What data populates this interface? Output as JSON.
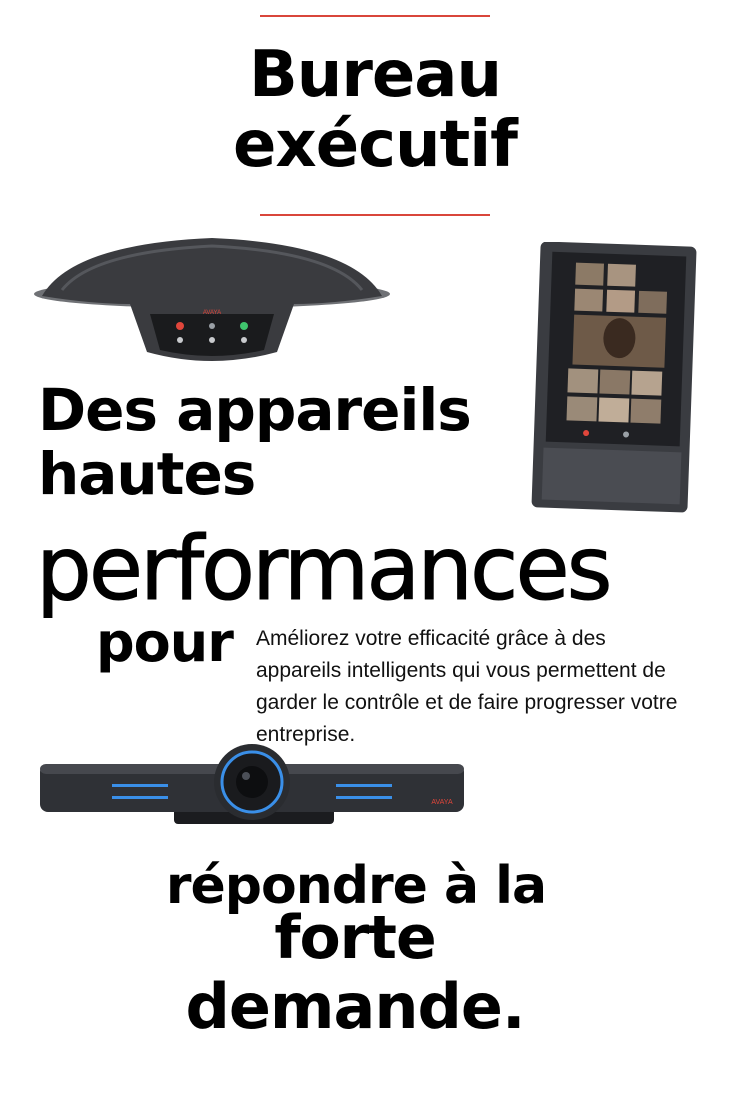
{
  "header": {
    "title_line1": "Bureau",
    "title_line2": "exécutif"
  },
  "headline": {
    "line1": "Des appareils",
    "line2": "hautes",
    "line3": "performances",
    "line4": "pour"
  },
  "description": "Améliorez votre efficacité grâce à des appareils intelligents qui vous permettent de garder le contrôle et de faire progresser votre entreprise.",
  "closing": {
    "line1": "répondre à la",
    "line2": "forte",
    "line3": "demande."
  },
  "devices": {
    "speakerphone_icon": "conference-speakerphone",
    "tablet_icon": "video-collaboration-tablet",
    "camera_icon": "conference-camera-bar"
  },
  "brand_label": "AVAYA",
  "colors": {
    "accent": "#d9463b",
    "text": "#000000",
    "background": "#ffffff",
    "device_dark": "#2b2d31",
    "camera_blue": "#3a8fe8"
  }
}
